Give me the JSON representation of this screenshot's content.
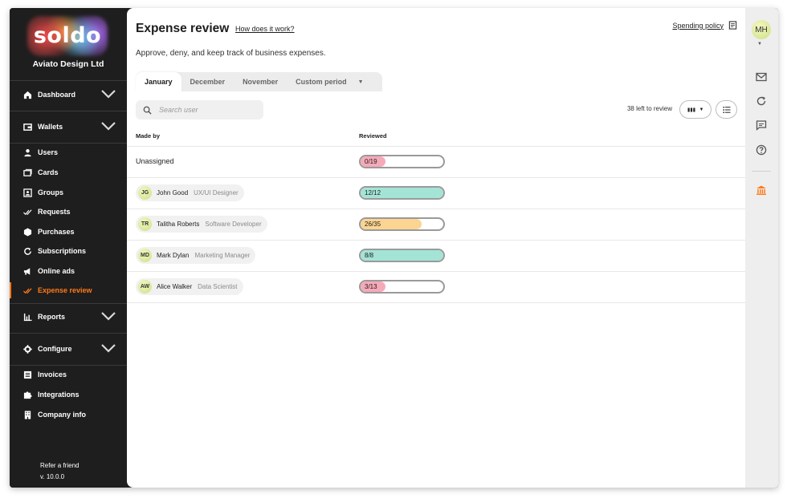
{
  "sidebar": {
    "logo_text": "soldo",
    "company": "Aviato Design Ltd",
    "items": [
      {
        "label": "Dashboard",
        "icon": "home-icon"
      },
      {
        "label": "Wallets",
        "icon": "wallet-icon"
      },
      {
        "label": "Users",
        "icon": "user-icon"
      },
      {
        "label": "Cards",
        "icon": "cards-icon"
      },
      {
        "label": "Groups",
        "icon": "groups-icon"
      },
      {
        "label": "Requests",
        "icon": "double-check-icon"
      },
      {
        "label": "Purchases",
        "icon": "hexagon-icon"
      },
      {
        "label": "Subscriptions",
        "icon": "refresh-icon"
      },
      {
        "label": "Online ads",
        "icon": "megaphone-icon"
      },
      {
        "label": "Expense review",
        "icon": "check-icon"
      },
      {
        "label": "Reports",
        "icon": "bar-chart-icon"
      },
      {
        "label": "Configure",
        "icon": "gear-icon"
      },
      {
        "label": "Invoices",
        "icon": "list-icon"
      },
      {
        "label": "Integrations",
        "icon": "puzzle-icon"
      },
      {
        "label": "Company info",
        "icon": "building-icon"
      }
    ],
    "refer": "Refer a friend",
    "version": "v. 10.0.0"
  },
  "header": {
    "title": "Expense review",
    "how_link": "How does it work?",
    "policy_link": "Spending policy",
    "subtitle": "Approve, deny, and keep track of business expenses."
  },
  "tabs": [
    {
      "label": "January"
    },
    {
      "label": "December"
    },
    {
      "label": "November"
    },
    {
      "label": "Custom period"
    }
  ],
  "search": {
    "placeholder": "Search user"
  },
  "review_count": "38 left to review",
  "table": {
    "headers": {
      "made_by": "Made by",
      "reviewed": "Reviewed"
    },
    "unassigned": "Unassigned",
    "rows": [
      {
        "initials": "",
        "name": "Unassigned",
        "role": "",
        "reviewed": "0/19",
        "progress": 0.3,
        "color": "#f6a9b9"
      },
      {
        "initials": "JG",
        "name": "John Good",
        "role": "UX/UI Designer",
        "reviewed": "12/12",
        "progress": 1.0,
        "color": "#a3e4d6"
      },
      {
        "initials": "TR",
        "name": "Talitha Roberts",
        "role": "Software Developer",
        "reviewed": "26/35",
        "progress": 0.74,
        "color": "#fbd591"
      },
      {
        "initials": "MD",
        "name": "Mark Dylan",
        "role": "Marketing Manager",
        "reviewed": "8/8",
        "progress": 1.0,
        "color": "#a3e4d6"
      },
      {
        "initials": "AW",
        "name": "Alice Walker",
        "role": "Data Scientist",
        "reviewed": "3/13",
        "progress": 0.3,
        "color": "#f6a9b9"
      }
    ]
  },
  "rail": {
    "avatar": "MH"
  },
  "colors": {
    "accent": "#ff7a1a",
    "sidebar_bg": "#1e1e1e"
  }
}
